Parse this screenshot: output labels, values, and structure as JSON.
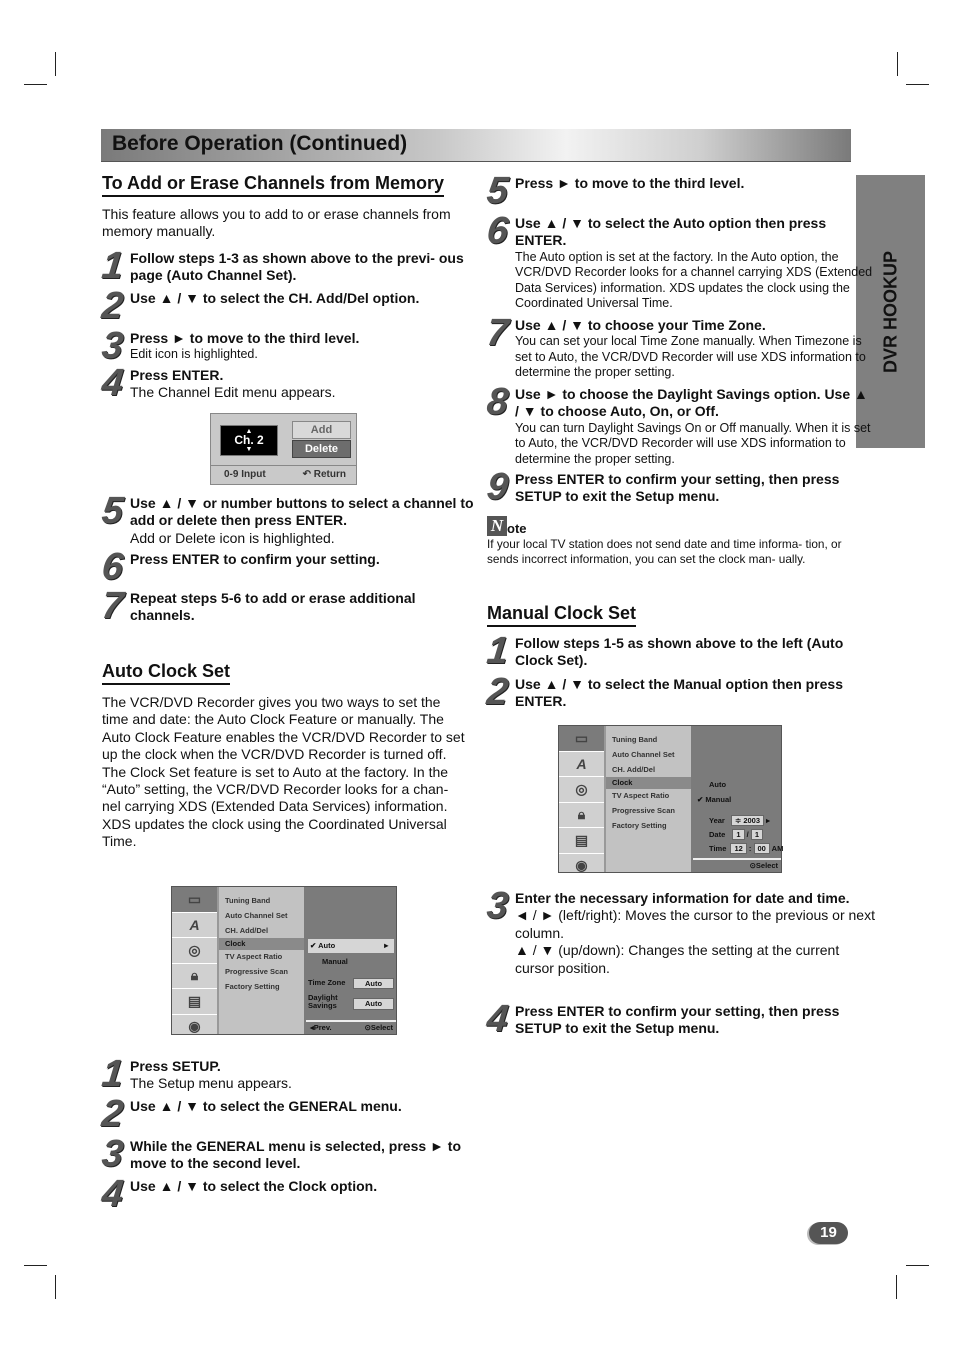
{
  "header": {
    "title": "Before Operation (Continued)",
    "side_tab": "DVR HOOKUP",
    "page_number": "19"
  },
  "add_erase": {
    "heading": "To Add or Erase Channels from Memory",
    "intro": "This feature allows you to add to or erase channels from memory manually.",
    "steps": [
      {
        "num": "1",
        "bold": "Follow steps 1-3 as shown above to the previ- ous page (Auto Channel Set).",
        "body": ""
      },
      {
        "num": "2",
        "bold": "Use ▲ / ▼ to select the CH. Add/Del option.",
        "body": ""
      },
      {
        "num": "3",
        "bold": "Press ► to move to the third level.",
        "body": "Edit icon is highlighted."
      },
      {
        "num": "4",
        "bold": "Press ENTER.",
        "body": "The Channel Edit menu appears."
      },
      {
        "num": "5",
        "bold": "Use ▲ / ▼ or number buttons to select a channel to add or delete then press ENTER.",
        "body": "Add or Delete icon is highlighted."
      },
      {
        "num": "6",
        "bold": "Press ENTER to confirm your setting.",
        "body": ""
      },
      {
        "num": "7",
        "bold": "Repeat steps 5-6 to add or erase additional channels.",
        "body": ""
      }
    ],
    "channel_edit": {
      "channel": "Ch. 2",
      "up": "▲",
      "down": "▼",
      "add": "Add",
      "delete": "Delete",
      "input_hint": "0-9 Input",
      "return_label": "Return",
      "return_icon": "↶"
    }
  },
  "auto_clock": {
    "heading": "Auto Clock Set",
    "para1": "The VCR/DVD Recorder gives you two ways to set the time and date: the Auto Clock Feature or manually. The Auto Clock Feature enables the VCR/DVD Recorder to set up the clock when the VCR/DVD Recorder is turned off.",
    "para2": "The Clock Set feature is set to Auto at the factory. In the “Auto” setting, the VCR/DVD Recorder looks for a chan- nel carrying XDS (Extended Data Services) information. XDS updates the clock using the Coordinated Universal Time.",
    "menu": {
      "items": [
        "Tuning Band",
        "Auto Channel Set",
        "CH. Add/Del",
        "Clock",
        "TV Aspect Ratio",
        "Progressive Scan",
        "Factory Setting"
      ],
      "opt_auto": "Auto",
      "opt_manual": "Manual",
      "check": "✔",
      "arrow": "►",
      "time_zone_label": "Time Zone",
      "time_zone_value": "Auto",
      "daylight_label_1": "Daylight",
      "daylight_label_2": "Savings",
      "daylight_value": "Auto",
      "prev": "◂Prev.",
      "select": "⊙Select"
    },
    "steps_left": [
      {
        "num": "1",
        "bold": "Press SETUP.",
        "body": "The Setup menu appears."
      },
      {
        "num": "2",
        "bold": "Use ▲ / ▼ to select the GENERAL menu.",
        "body": ""
      },
      {
        "num": "3",
        "bold": "While the GENERAL menu is selected, press ► to move to the second level.",
        "body": ""
      },
      {
        "num": "4",
        "bold": "Use ▲ / ▼ to select the Clock option.",
        "body": ""
      }
    ],
    "steps_right": [
      {
        "num": "5",
        "bold": "Press ► to move to the third level.",
        "body": ""
      },
      {
        "num": "6",
        "bold": "Use ▲ / ▼ to select the Auto option then press ENTER.",
        "body": "The Auto option is set at the factory. In the Auto option, the VCR/DVD Recorder looks for a channel carrying XDS (Extended Data Services) information. XDS updates the clock using the Coordinated Universal Time."
      },
      {
        "num": "7",
        "bold": "Use ▲ / ▼ to choose your Time Zone.",
        "body": "You can set your local Time Zone manually. When Timezone is set to Auto, the VCR/DVD Recorder will use XDS information to determine the proper setting."
      },
      {
        "num": "8",
        "bold": "Use ► to choose the Daylight Savings option. Use ▲ / ▼ to choose Auto, On, or Off.",
        "body": "You can turn Daylight Savings On or Off manually. When it is set to Auto, the VCR/DVD Recorder will use XDS information to determine the proper setting."
      },
      {
        "num": "9",
        "bold": "Press ENTER to confirm your setting, then press SETUP to exit the Setup menu.",
        "body": ""
      }
    ]
  },
  "note": {
    "icon": "N",
    "label": "ote",
    "text": "If your local TV station does not send date and time informa- tion, or sends incorrect information, you can set the clock man- ually."
  },
  "manual_clock": {
    "heading": "Manual Clock Set",
    "steps": [
      {
        "num": "1",
        "bold": "Follow steps 1-5 as shown above to the left (Auto Clock Set).",
        "body": ""
      },
      {
        "num": "2",
        "bold": "Use ▲ / ▼ to select the Manual option then press ENTER.",
        "body": ""
      },
      {
        "num": "3",
        "bold": "Enter the necessary information for date and time.",
        "body1": "◄ / ► (left/right): Moves the cursor to the previous or next column.",
        "body2": "▲ / ▼ (up/down): Changes the setting at the current cursor position."
      },
      {
        "num": "4",
        "bold": "Press ENTER to confirm your setting, then press SETUP to exit the Setup menu.",
        "body": ""
      }
    ],
    "menu": {
      "items": [
        "Tuning Band",
        "Auto Channel Set",
        "CH. Add/Del",
        "Clock",
        "TV Aspect Ratio",
        "Progressive Scan",
        "Factory Setting"
      ],
      "opt_auto": "Auto",
      "opt_manual": "Manual",
      "check": "✔",
      "year_label": "Year",
      "year_value": "≑ 2003",
      "year_arrow": "▸",
      "date_label": "Date",
      "date_month": "1",
      "date_sep": "/",
      "date_day": "1",
      "time_label": "Time",
      "time_hour": "12",
      "time_sep": ":",
      "time_min": "00",
      "ampm": "AM",
      "select": "⊙Select"
    }
  }
}
